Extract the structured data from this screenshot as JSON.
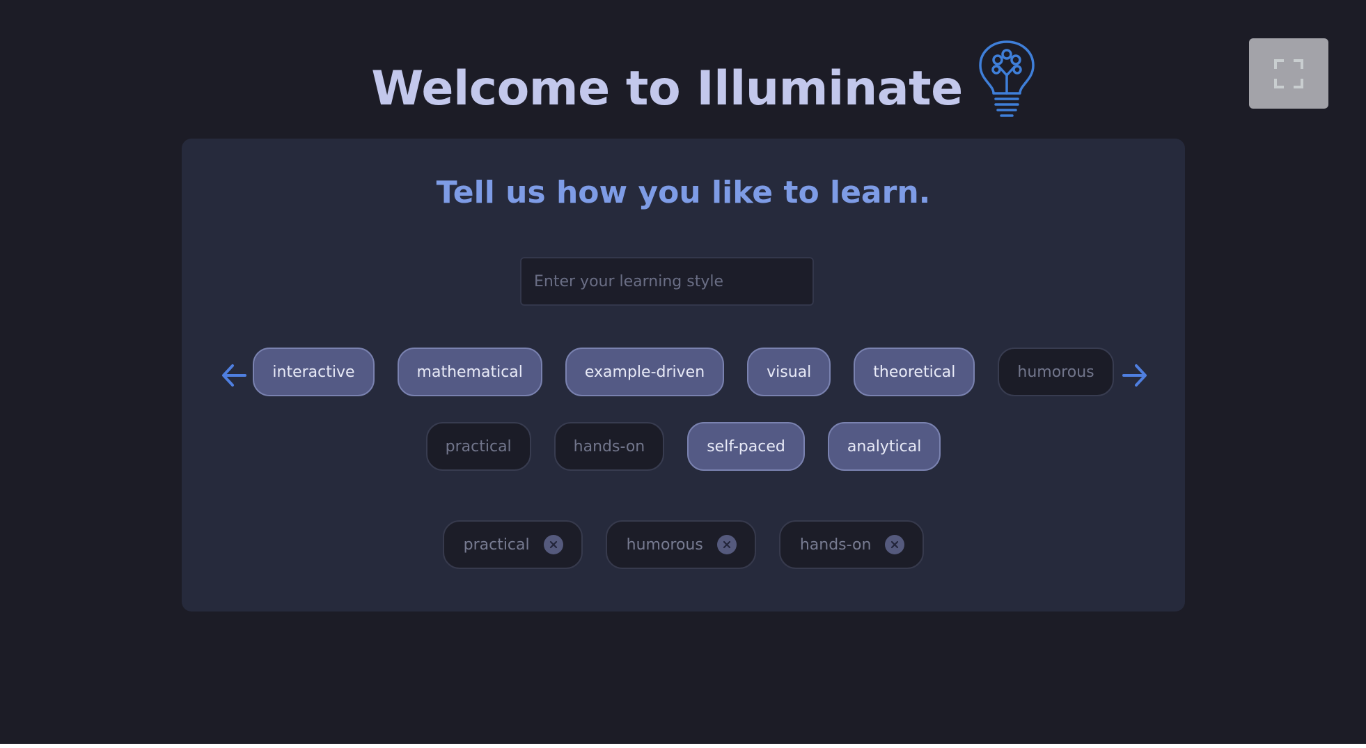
{
  "header": {
    "title": "Welcome to Illuminate",
    "logo_icon": "lightbulb-icon"
  },
  "fullscreen": {
    "icon": "fullscreen-icon"
  },
  "card": {
    "title": "Tell us how you like to learn.",
    "input_placeholder": "Enter your learning style",
    "input_value": "",
    "prev_icon": "arrow-left-icon",
    "next_icon": "arrow-right-icon",
    "chips_row1": [
      {
        "label": "interactive",
        "selected": true
      },
      {
        "label": "mathematical",
        "selected": true
      },
      {
        "label": "example-driven",
        "selected": true
      },
      {
        "label": "visual",
        "selected": true
      },
      {
        "label": "theoretical",
        "selected": true
      },
      {
        "label": "humorous",
        "selected": false
      }
    ],
    "chips_row2": [
      {
        "label": "practical",
        "selected": false
      },
      {
        "label": "hands-on",
        "selected": false
      },
      {
        "label": "self-paced",
        "selected": true
      },
      {
        "label": "analytical",
        "selected": true
      }
    ],
    "chosen_tags": [
      {
        "label": "practical",
        "remove_icon": "close-icon"
      },
      {
        "label": "humorous",
        "remove_icon": "close-icon"
      },
      {
        "label": "hands-on",
        "remove_icon": "close-icon"
      }
    ]
  },
  "colors": {
    "background": "#1c1c26",
    "card": "#262a3c",
    "title_accent": "#7e9ce6",
    "heading": "#c3c8ec",
    "arrow": "#4f7fe0",
    "chip_selected": "#545a85"
  }
}
